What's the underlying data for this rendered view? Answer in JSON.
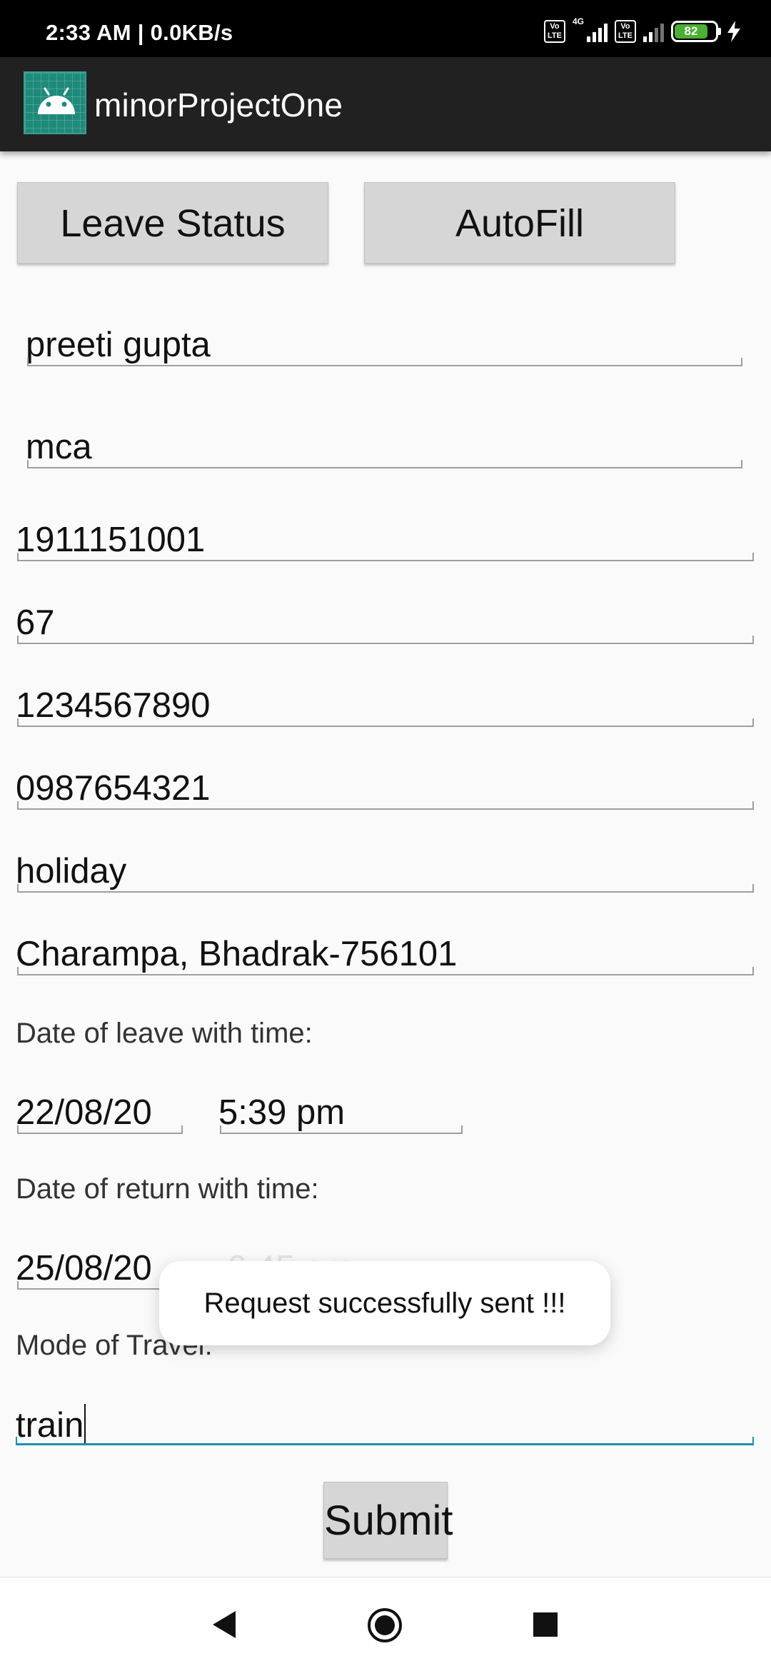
{
  "status_bar": {
    "time_text": "2:33 AM | 0.0KB/s",
    "volte_label": "Vo LTE",
    "network_label": "4G",
    "battery_level": "82",
    "icons": [
      "volte-icon",
      "signal-icon",
      "battery-icon",
      "charging-icon"
    ]
  },
  "app_bar": {
    "title": "minorProjectOne",
    "icon": "android-icon"
  },
  "buttons": {
    "leave_status": "Leave Status",
    "autofill": "AutoFill",
    "submit": "Submit"
  },
  "form": {
    "name": "preeti gupta",
    "course": "mca",
    "roll_number": "1911151001",
    "field_67": "67",
    "phone_1": "1234567890",
    "phone_2": "0987654321",
    "reason": "holiday",
    "address": "Charampa, Bhadrak-756101",
    "leave_label": "Date of leave with time:",
    "leave_date": "22/08/20",
    "leave_time": "5:39 pm",
    "return_label": "Date of return with time:",
    "return_date": "25/08/20",
    "return_time": "6:45 am",
    "travel_label": "Mode of Travel:",
    "travel_mode": "train"
  },
  "toast": {
    "message": "Request successfully sent !!!"
  },
  "nav_bar": {
    "icons": [
      "back-icon",
      "home-icon",
      "recents-icon"
    ]
  },
  "colors": {
    "status_bar": "#000000",
    "app_bar": "#212121",
    "background": "#fafafa",
    "button": "#d6d6d6",
    "focus_underline": "#1a8fb5",
    "battery": "#4caf33"
  }
}
